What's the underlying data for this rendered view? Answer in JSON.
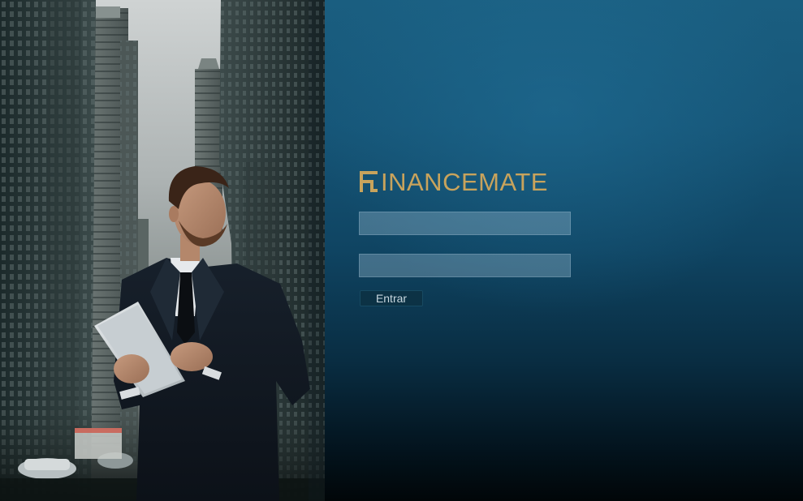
{
  "colors": {
    "brand_gold": "#c8a35c",
    "panel_top": "#1a5e80",
    "panel_bottom": "#010608",
    "button_bg": "#0c3245"
  },
  "hero": {
    "description_icon": "businessman-city-photo"
  },
  "login": {
    "logo_text": "INANCEMATE",
    "logo_mark_icon": "financemate-f-logo-icon",
    "username": {
      "value": "",
      "placeholder": ""
    },
    "password": {
      "value": "",
      "placeholder": ""
    },
    "submit_label": "Entrar"
  }
}
